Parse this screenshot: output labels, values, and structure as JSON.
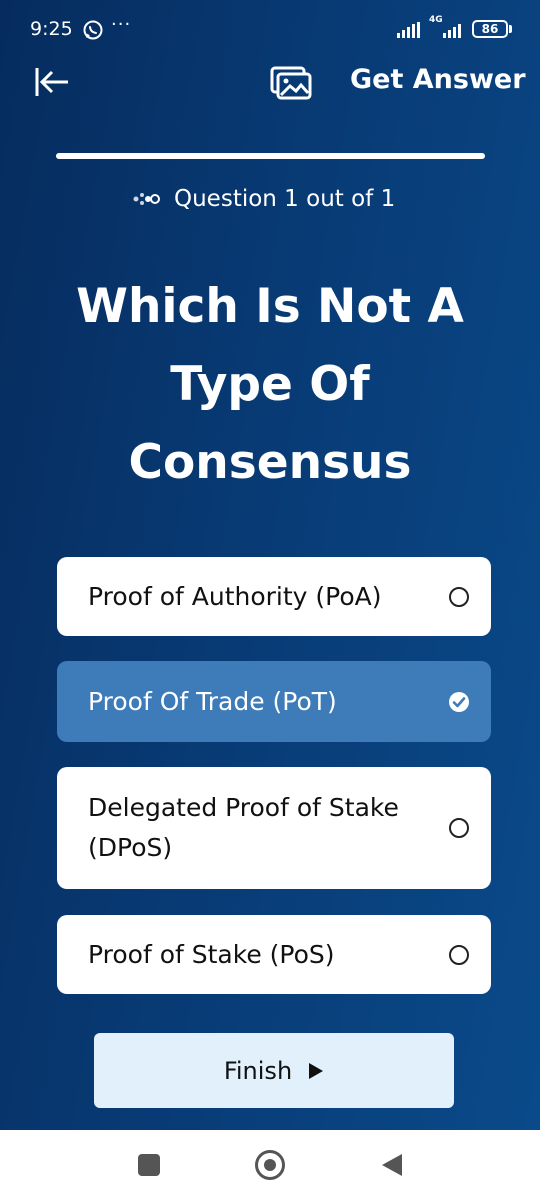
{
  "status_bar": {
    "time": "9:25",
    "more": "···",
    "network": "4G",
    "battery": "86"
  },
  "toolbar": {
    "get_answer_label": "Get Answer"
  },
  "progress": {
    "fraction": 1.0
  },
  "question": {
    "counter": "Question 1 out of 1",
    "title": "Which Is Not A Type Of Consensus"
  },
  "options": [
    {
      "label": "Proof of Authority (PoA)",
      "selected": false
    },
    {
      "label": "Proof Of Trade (PoT)",
      "selected": true
    },
    {
      "label": "Delegated Proof of Stake (DPoS)",
      "selected": false
    },
    {
      "label": "Proof of Stake (PoS)",
      "selected": false
    }
  ],
  "finish": {
    "label": "Finish"
  },
  "colors": {
    "background": "#083a74",
    "selected_option": "#3e7bb9",
    "finish_button": "#e2f0fb"
  }
}
